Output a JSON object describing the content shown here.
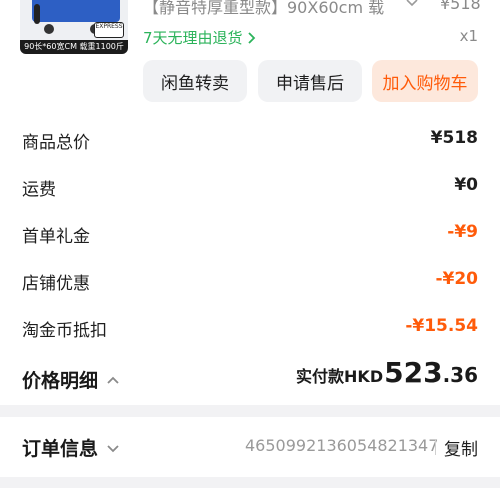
{
  "product": {
    "title": "【静音特厚重型款】90X60cm 载",
    "price": "¥518",
    "return_policy": "7天无理由退货",
    "quantity": "x1",
    "thumbnail": {
      "strip_text": "90长*60宽CM 载重1100斤",
      "badge_text": "EXPRESS"
    }
  },
  "actions": {
    "resell_label": "闲鱼转卖",
    "aftersale_label": "申请售后",
    "add_to_cart_label": "加入购物车"
  },
  "price_breakdown": {
    "rows": [
      {
        "label": "商品总价",
        "value": "¥518",
        "negative": false
      },
      {
        "label": "运费",
        "value": "¥0",
        "negative": false
      },
      {
        "label": "首单礼金",
        "value": "-¥9",
        "negative": true
      },
      {
        "label": "店铺优惠",
        "value": "-¥20",
        "negative": true
      },
      {
        "label": "淘金币抵扣",
        "value": "-¥15.54",
        "negative": true
      }
    ],
    "detail_label": "价格明细",
    "paid_label": "实付款HKD",
    "paid_integer": "523",
    "paid_decimal": ".36"
  },
  "order": {
    "label": "订单信息",
    "number": "4650992136054821347",
    "copy_label": "复制"
  },
  "colors": {
    "accent": "#ff5b0a",
    "accent_bg": "#fde8dc",
    "green": "#2bb35a",
    "muted": "#8a8a8a",
    "background": "#f2f2f4"
  }
}
